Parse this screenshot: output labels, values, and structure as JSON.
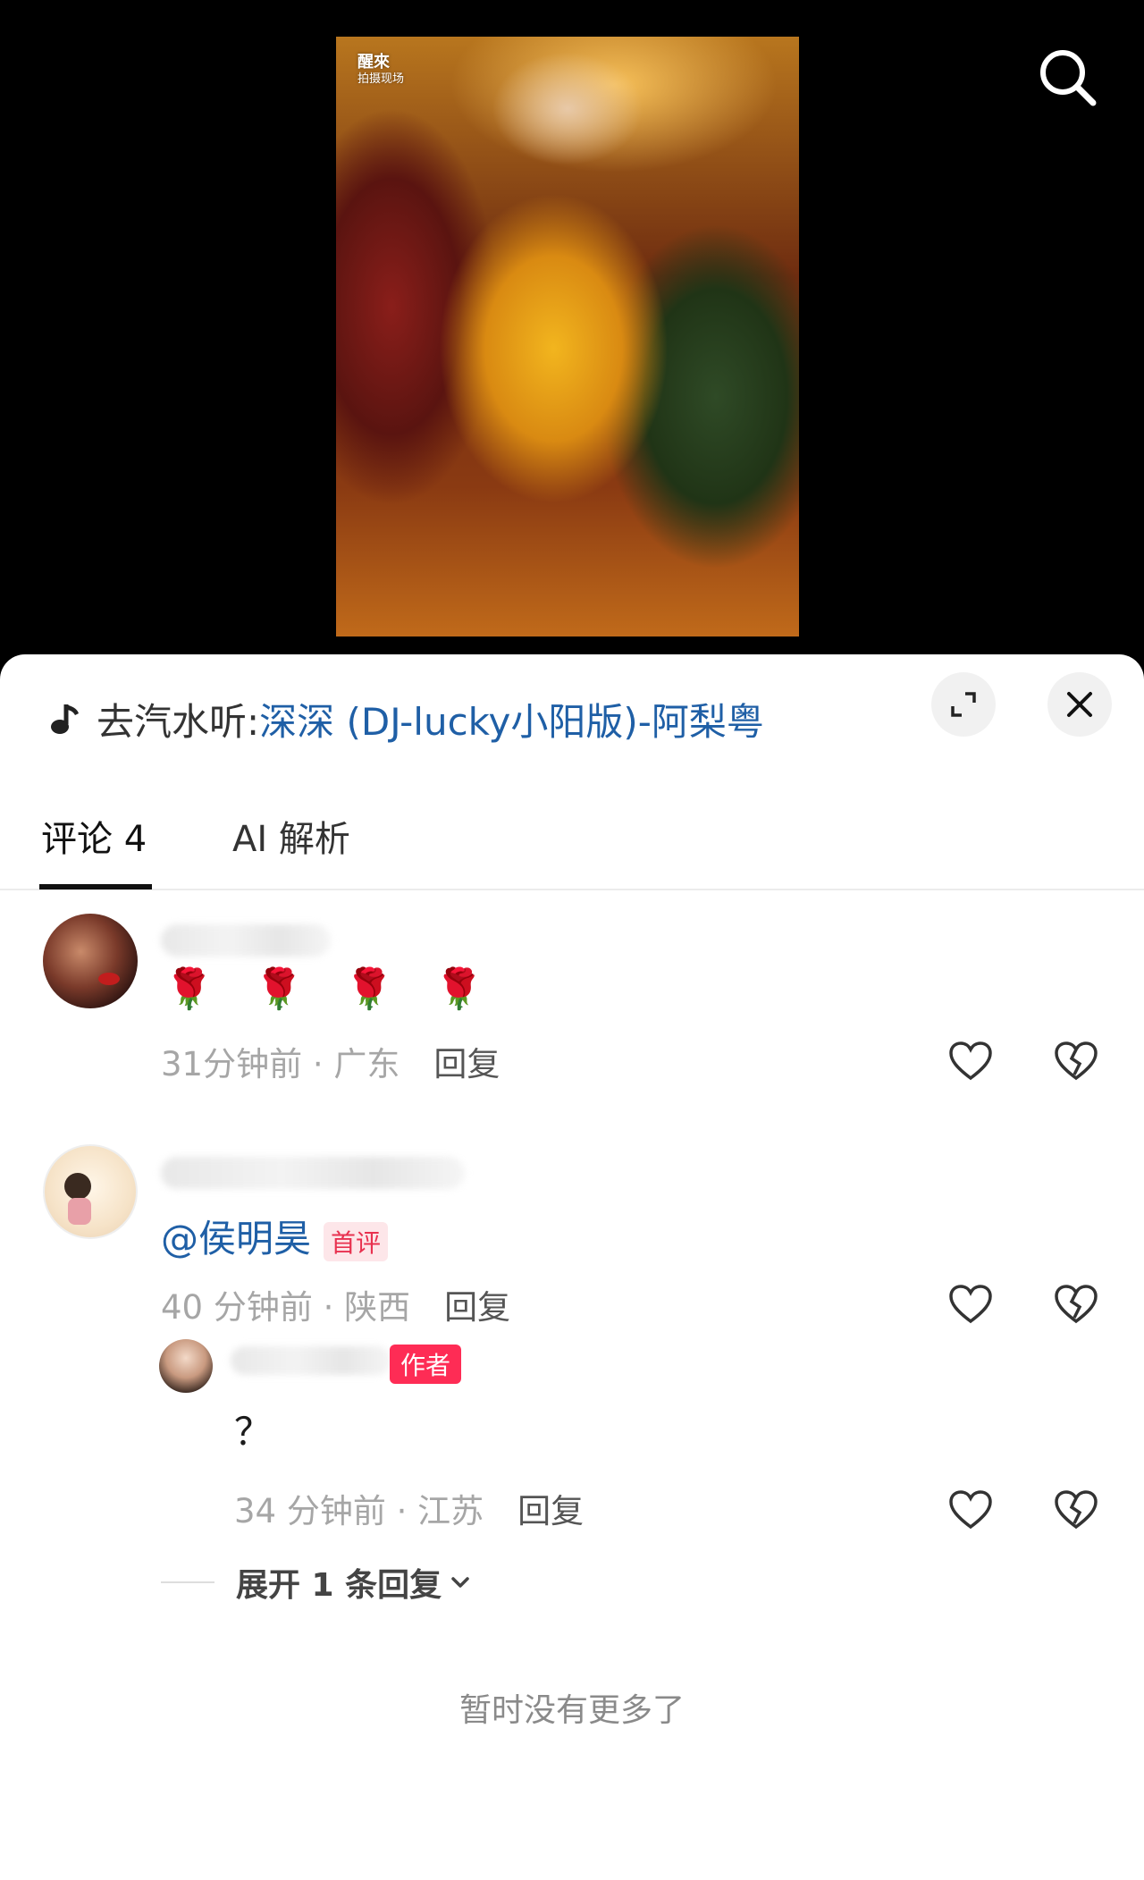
{
  "video": {
    "watermark_title": "醒來",
    "watermark_sub": "拍摄现场"
  },
  "music": {
    "prefix": "去汽水听:",
    "song": "深深 (DJ-lucky小阳版)-阿梨粤"
  },
  "tabs": {
    "comments_label": "评论 4",
    "ai_label": "AI 解析"
  },
  "comments": [
    {
      "text": "🌹 🌹 🌹 🌹",
      "time": "31分钟前 · 广东",
      "reply_label": "回复"
    },
    {
      "mention": "@侯明昊",
      "badge": "首评",
      "time": "40 分钟前 · 陕西",
      "reply_label": "回复",
      "replies": [
        {
          "badge": "作者",
          "text": "？",
          "time": "34 分钟前 · 江苏",
          "reply_label": "回复"
        }
      ],
      "expand_label": "展开 1 条回复"
    }
  ],
  "footer": {
    "end_text": "暂时没有更多了"
  },
  "icons": {
    "search": "search-icon",
    "expand": "expand-icon",
    "close": "close-icon",
    "like": "heart-icon",
    "dislike": "broken-heart-icon",
    "music": "music-note-icon",
    "chevron": "chevron-down-icon"
  },
  "colors": {
    "link": "#1f5fa6",
    "author_badge": "#fe2c55",
    "first_badge_text": "#e8314f"
  }
}
